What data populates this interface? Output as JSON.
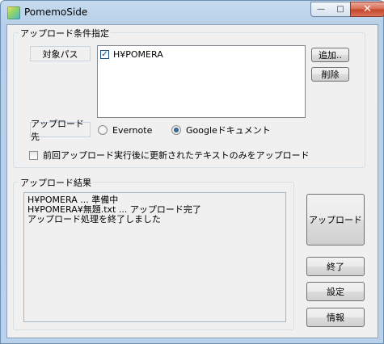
{
  "window": {
    "title": "PomemoSide"
  },
  "upload_conditions": {
    "title": "アップロード条件指定",
    "target_label": "対象パス",
    "paths": [
      {
        "path": "H¥POMERA",
        "checked": true
      }
    ],
    "add_label": "追加..",
    "delete_label": "削除",
    "destination_label": "アップロード先",
    "destinations": [
      {
        "label": "Evernote",
        "selected": false
      },
      {
        "label": "Googleドキュメント",
        "selected": true
      }
    ],
    "only_updated_label": "前回アップロード実行後に更新されたテキストのみをアップロード",
    "only_updated_checked": false
  },
  "upload_results": {
    "title": "アップロード結果",
    "lines": [
      "H¥POMERA ... 準備中",
      "H¥POMERA¥無題.txt ... アップロード完了",
      "アップロード処理を終了しました"
    ]
  },
  "actions": {
    "upload_label": "アップロード",
    "exit_label": "終了",
    "settings_label": "設定",
    "info_label": "情報"
  }
}
